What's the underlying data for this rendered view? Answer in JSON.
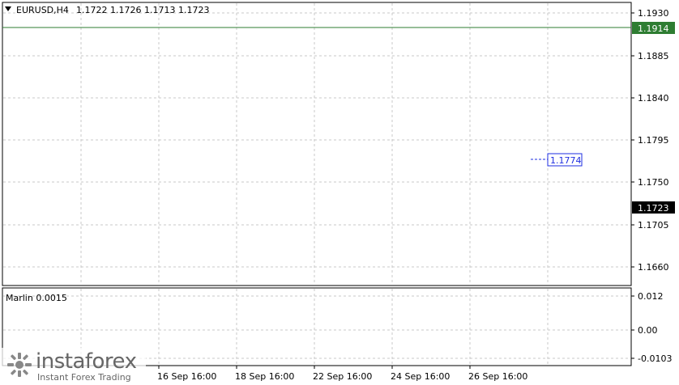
{
  "header": {
    "symbol": "EURUSD,H4",
    "ohlc": "1.1722 1.1726 1.1713 1.1723"
  },
  "indicator": {
    "name": "Marlin 0.0015"
  },
  "price_axis": {
    "ticks": [
      "1.1930",
      "1.1885",
      "1.1840",
      "1.1795",
      "1.1750",
      "1.1705",
      "1.1660"
    ],
    "tag_level": "1.1914",
    "tag_current": "1.1723",
    "tag_ma": "1.1774"
  },
  "indicator_axis": {
    "ticks": [
      "0.012",
      "0.00",
      "-0.0103"
    ]
  },
  "time_axis": {
    "labels": [
      "16 Sep 16:00",
      "18 Sep 16:00",
      "22 Sep 16:00",
      "24 Sep 16:00",
      "26 Sep 16:00"
    ]
  },
  "watermark": {
    "name": "instaforex",
    "tagline": "Instant Forex Trading"
  },
  "colors": {
    "level_line": "#2e7d32",
    "ma_fast": "#e0202a",
    "ma_slow": "#1e2ee0",
    "oscillator": "#a020a0",
    "grid": "#c8c8c8",
    "axis_tag_blue": "#1e2ee0"
  },
  "chart_data": [
    {
      "type": "candlestick",
      "title": "EURUSD,H4",
      "ylim": [
        1.1643,
        1.1945
      ],
      "x_labels": [
        "16 Sep 16:00",
        "18 Sep 16:00",
        "22 Sep 16:00",
        "24 Sep 16:00",
        "26 Sep 16:00"
      ],
      "horizontal_levels": [
        1.1914
      ],
      "tags": {
        "current": 1.1723,
        "ma_slow_last": 1.1774
      },
      "grid": true
    },
    {
      "type": "line",
      "title": "Marlin 0.0015",
      "ylim": [
        -0.0125,
        0.0145
      ],
      "ticks": [
        0.012,
        0.0,
        -0.0103
      ],
      "grid": true
    }
  ]
}
